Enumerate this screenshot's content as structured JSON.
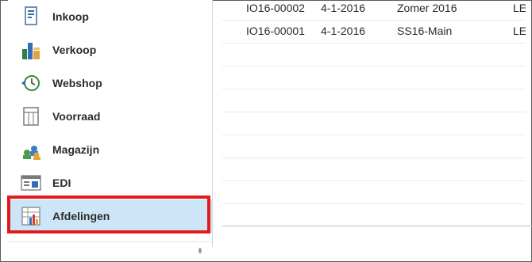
{
  "nav": {
    "items": [
      {
        "label": "Inkoop",
        "icon": "purchase-icon"
      },
      {
        "label": "Verkoop",
        "icon": "sales-icon"
      },
      {
        "label": "Webshop",
        "icon": "webshop-icon"
      },
      {
        "label": "Voorraad",
        "icon": "stock-icon"
      },
      {
        "label": "Magazijn",
        "icon": "warehouse-icon"
      },
      {
        "label": "EDI",
        "icon": "edi-icon"
      },
      {
        "label": "Afdelingen",
        "icon": "departments-icon",
        "selected": true
      }
    ],
    "overflow_glyph": "⇟"
  },
  "grid": {
    "rows": [
      {
        "nr": "IO16-00002",
        "date": "4-1-2016",
        "desc": "Zomer 2016",
        "extra": "LE"
      },
      {
        "nr": "IO16-00001",
        "date": "4-1-2016",
        "desc": "SS16-Main",
        "extra": "LE"
      }
    ]
  },
  "colors": {
    "selected_bg": "#cde6f7",
    "highlight_border": "#e11b1b"
  }
}
